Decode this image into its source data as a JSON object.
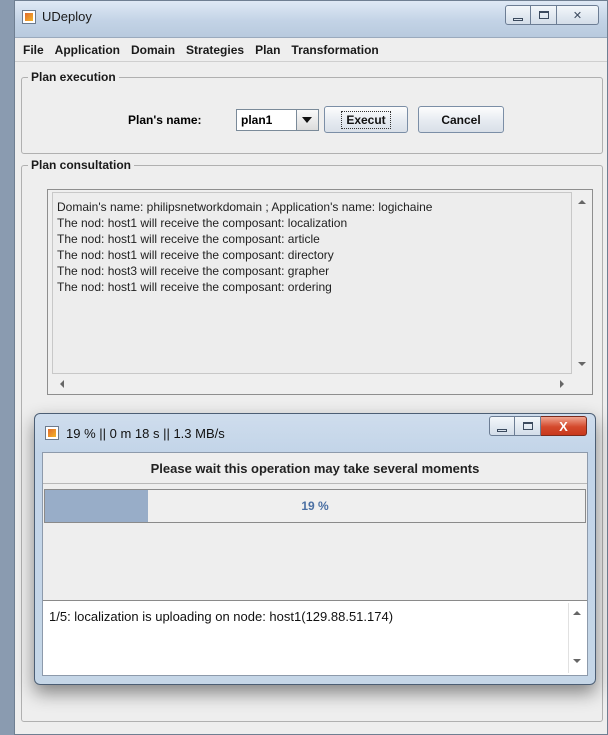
{
  "window": {
    "title": "UDeploy",
    "icon": "java-cup-icon"
  },
  "menubar": {
    "items": [
      "File",
      "Application",
      "Domain",
      "Strategies",
      "Plan",
      "Transformation"
    ]
  },
  "plan_execution": {
    "legend": "Plan execution",
    "plan_name_label": "Plan's name:",
    "plan_name_value": "plan1",
    "execute_label": "Execut",
    "cancel_label": "Cancel"
  },
  "plan_consultation": {
    "legend": "Plan consultation",
    "lines": [
      "Domain's name: philipsnetworkdomain ; Application's name: logichaine",
      "",
      "The nod: host1 will receive the composant: localization",
      "The nod: host1 will receive the composant: article",
      "The nod: host1 will receive the composant: directory",
      "The nod: host3 will receive the composant: grapher",
      "The nod: host1 will receive the composant: ordering"
    ]
  },
  "progress_dialog": {
    "title": "19 % || 0 m 18 s || 1.3 MB/s",
    "message": "Please wait this operation may take several moments",
    "progress_fraction": 0.19,
    "progress_text": "19 %",
    "log_text": "1/5: localization is uploading on node: host1(129.88.51.174)",
    "close_glyph": "X"
  },
  "colors": {
    "progress_fill": "#98adc8",
    "progress_text": "#4a6fa3",
    "close_button": "#d4492c"
  }
}
